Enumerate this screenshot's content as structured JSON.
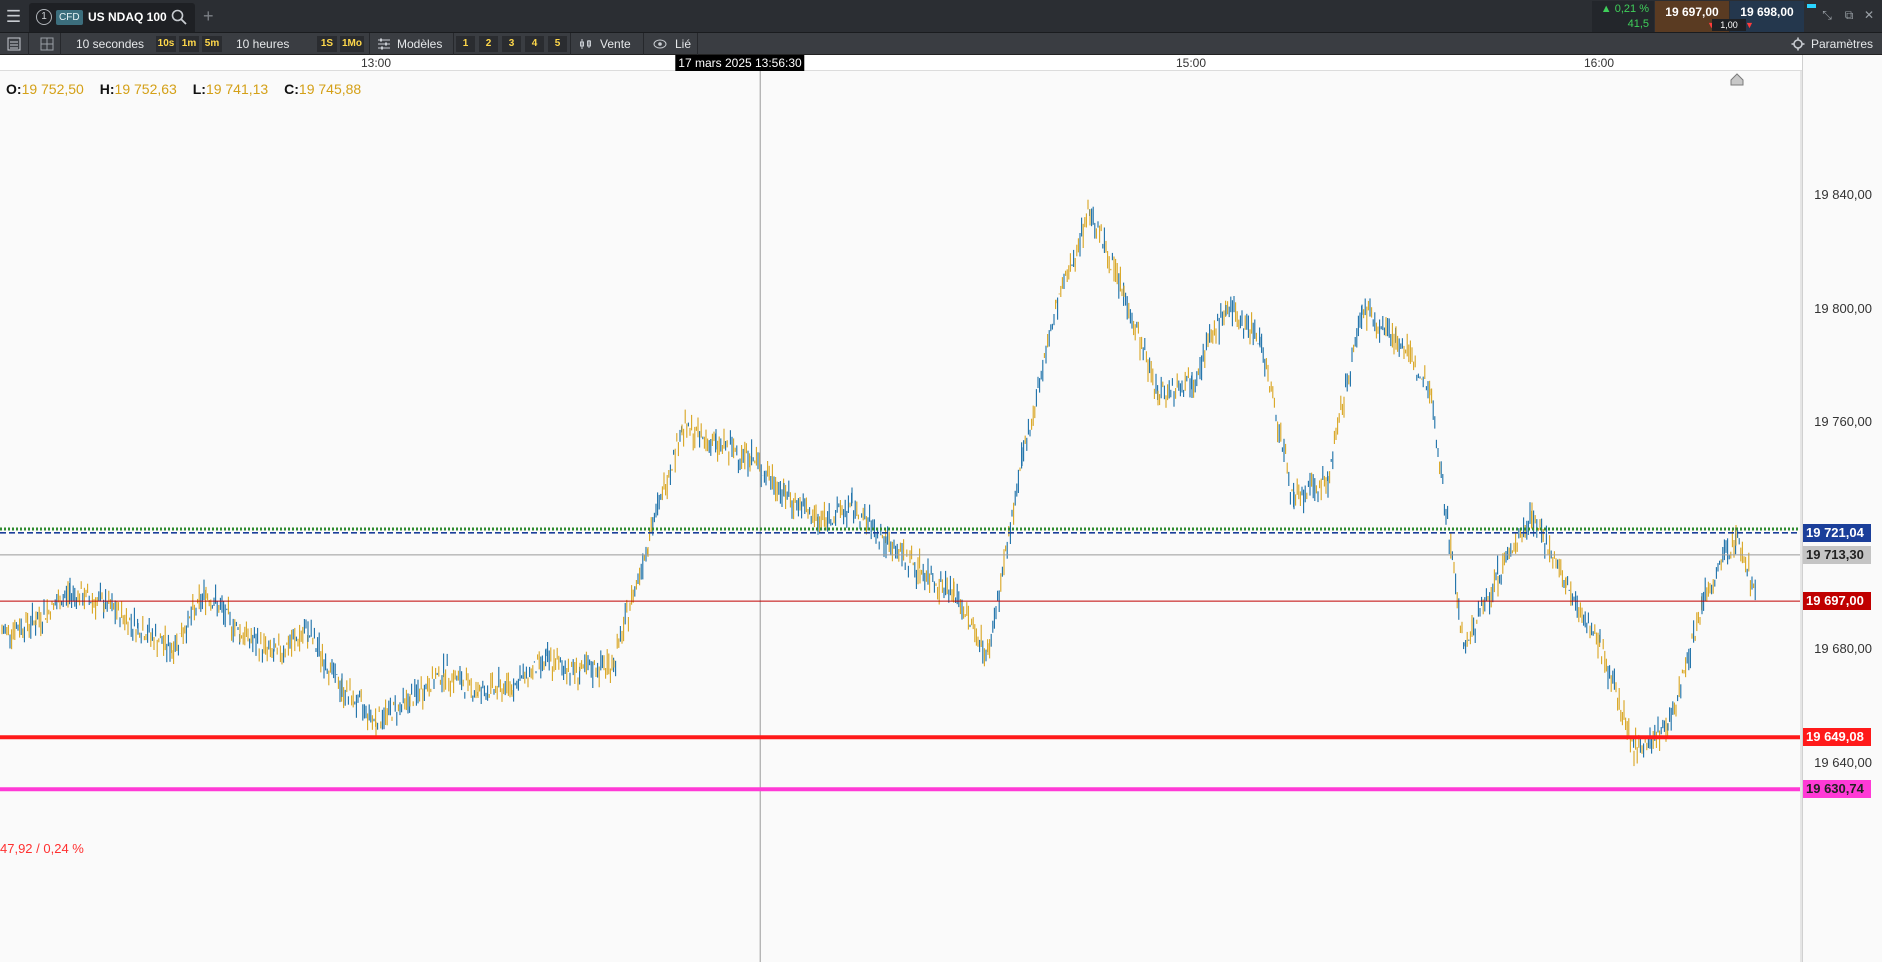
{
  "topbar": {
    "menu_icon": "hamburger-icon",
    "tab": {
      "number": "1",
      "badge": "CFD",
      "title": "US NDAQ 100"
    },
    "change_pct": "▲ 0,21 %",
    "change_pts": "41,5",
    "sell_price": "19 697,00",
    "buy_price": "19 698,00",
    "spread": "1,00",
    "colors": {
      "bg": "#2b2e33",
      "sell": "#5a3b22",
      "buy": "#24374d",
      "up": "#3fcf5a"
    }
  },
  "toolbar": {
    "interval_label": "10 secondes",
    "quick_intervals": [
      "10s",
      "1m",
      "5m"
    ],
    "range_label": "10 heures",
    "quick_ranges": [
      "1S",
      "1Mo"
    ],
    "templates_label": "Modèles",
    "layout_buttons": [
      "1",
      "2",
      "3",
      "4",
      "5"
    ],
    "order_label": "Vente",
    "linked_label": "Lié",
    "settings_label": "Paramètres"
  },
  "timeaxis": {
    "ticks": [
      "13:00",
      "15:00",
      "16:00"
    ],
    "cursor_label": "17 mars 2025 13:56:30"
  },
  "ohlc": {
    "o_label": "O:",
    "o": "19 752,50",
    "h_label": "H:",
    "h": "19 752,63",
    "l_label": "L:",
    "l": "19 741,13",
    "c_label": "C:",
    "c": "19 745,88"
  },
  "pnl_label": "47,92 / 0,24 %",
  "chart_data": {
    "type": "line",
    "instrument": "US NDAQ 100",
    "x_axis": {
      "ticks": [
        "13:00",
        "15:00",
        "16:00"
      ],
      "range": [
        "12:05",
        "16:25"
      ]
    },
    "ylim": [
      19620,
      19860
    ],
    "y_ticks": [
      "19 840,00",
      "19 800,00",
      "19 760,00",
      "19 680,00",
      "19 640,00"
    ],
    "grid": false,
    "up_color": "#1a6fa8",
    "down_color": "#d9a521",
    "series": [
      {
        "x": [
          "12:05",
          "12:10",
          "12:15",
          "12:20",
          "12:25",
          "12:30",
          "12:35",
          "12:40",
          "12:45",
          "12:50",
          "12:55",
          "13:00",
          "13:05",
          "13:10",
          "13:15",
          "13:20",
          "13:25",
          "13:30",
          "13:35",
          "13:40",
          "13:45",
          "13:50",
          "13:55",
          "14:00",
          "14:05",
          "14:10",
          "14:15",
          "14:20",
          "14:25",
          "14:30",
          "14:35",
          "14:40",
          "14:45",
          "14:50",
          "14:55",
          "15:00",
          "15:05",
          "15:10",
          "15:15",
          "15:20",
          "15:25",
          "15:30",
          "15:35",
          "15:40",
          "15:45",
          "15:50",
          "15:55",
          "16:00",
          "16:05",
          "16:10",
          "16:15",
          "16:20",
          "16:23"
        ],
        "values": [
          19686,
          19690,
          19700,
          19696,
          19688,
          19680,
          19700,
          19686,
          19678,
          19686,
          19666,
          19655,
          19662,
          19672,
          19665,
          19667,
          19676,
          19672,
          19675,
          19718,
          19758,
          19752,
          19748,
          19735,
          19725,
          19730,
          19718,
          19708,
          19700,
          19678,
          19746,
          19800,
          19835,
          19805,
          19770,
          19775,
          19800,
          19790,
          19732,
          19740,
          19800,
          19790,
          19772,
          19680,
          19706,
          19728,
          19702,
          19682,
          19645,
          19652,
          19696,
          19720,
          19700
        ]
      }
    ],
    "levels": [
      {
        "label": "19 721,04",
        "value": 19721.04,
        "color": "#1b3f9a",
        "style": "dashed"
      },
      {
        "label": "19 713,30",
        "value": 19713.3,
        "color": "#9a9a9a",
        "style": "solid"
      },
      {
        "label": "19 697,00",
        "value": 19697.0,
        "color": "#c00000",
        "style": "solid"
      },
      {
        "label": "19 649,08",
        "value": 19649.08,
        "color": "#ff1a1a",
        "style": "thick"
      },
      {
        "label": "19 630,74",
        "value": 19630.74,
        "color": "#ff3ad6",
        "style": "thick"
      }
    ],
    "green_level": {
      "value": 19722.4,
      "color": "#2e8b2e"
    },
    "crosshair_time": "13:56:30"
  }
}
